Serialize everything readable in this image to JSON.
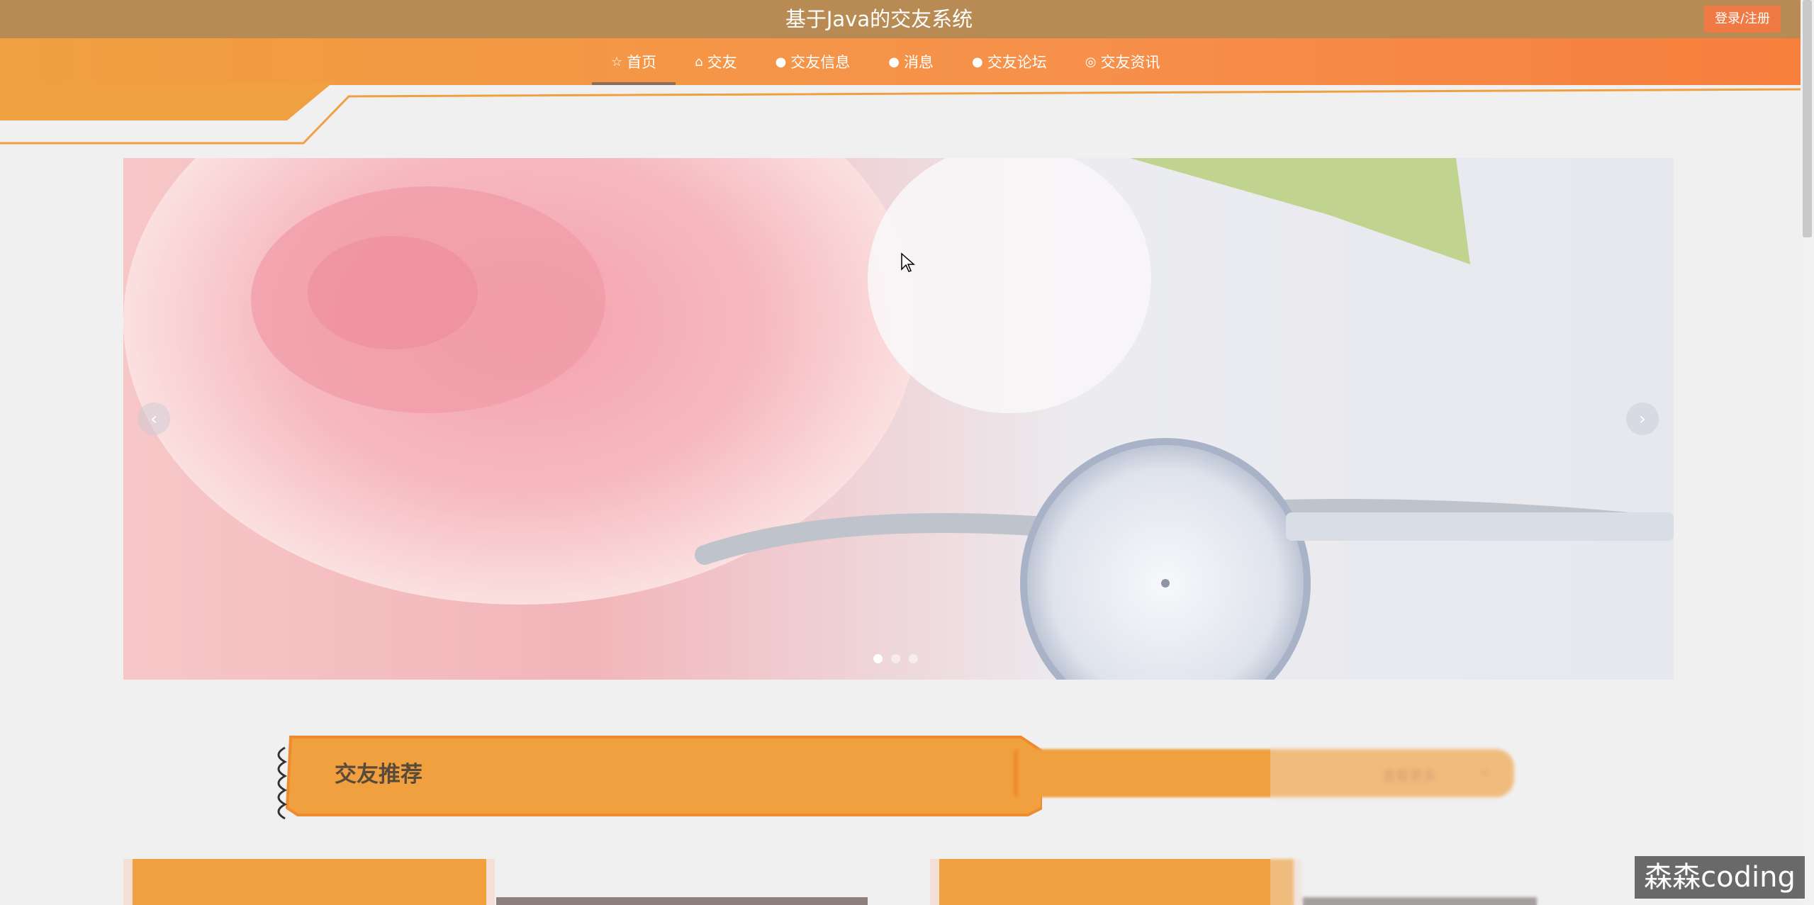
{
  "header": {
    "site_title": "基于Java的交友系统",
    "login_label": "登录/注册"
  },
  "nav": {
    "items": [
      {
        "icon": "star-icon",
        "glyph": "☆",
        "label": "首页",
        "active": true
      },
      {
        "icon": "bag-icon",
        "glyph": "⌂",
        "label": "交友",
        "active": false
      },
      {
        "icon": "info-icon",
        "glyph": "●",
        "label": "交友信息",
        "active": false
      },
      {
        "icon": "question-icon",
        "glyph": "●",
        "label": "消息",
        "active": false
      },
      {
        "icon": "info-circle-icon",
        "glyph": "●",
        "label": "交友论坛",
        "active": false
      },
      {
        "icon": "globe-icon",
        "glyph": "◎",
        "label": "交友资讯",
        "active": false
      }
    ]
  },
  "carousel": {
    "prev_glyph": "‹",
    "next_glyph": "›",
    "slide_count": 3,
    "active_slide": 1
  },
  "section": {
    "title": "交友推荐",
    "more_label": "查看更多",
    "more_glyph": "»"
  },
  "watermark": "森森coding",
  "colors": {
    "topbar": "#b88b55",
    "nav_gradient_start": "#f0a040",
    "nav_gradient_end": "#f67f3c",
    "accent_orange": "#f0a03f",
    "login_button": "#f07a44",
    "background": "#f1f0f1"
  }
}
